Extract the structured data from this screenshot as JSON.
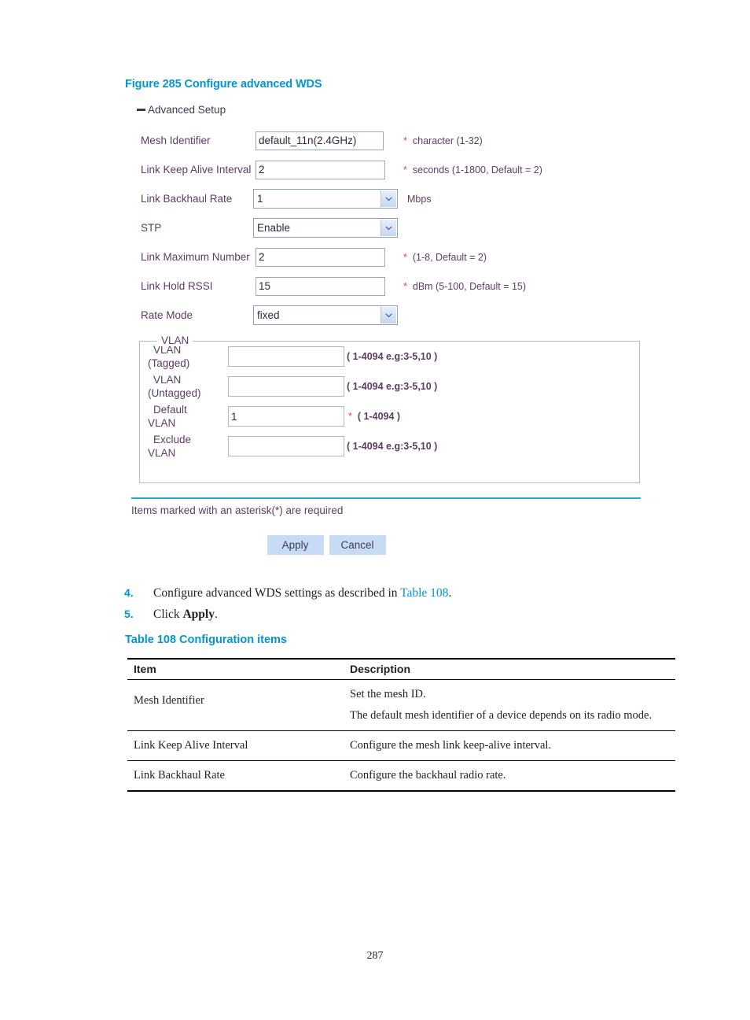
{
  "figure": {
    "caption": "Figure 285 Configure advanced WDS"
  },
  "ui": {
    "section_header": "Advanced Setup",
    "fields": [
      {
        "label": "Mesh Identifier",
        "type": "text",
        "value": "default_11n(2.4GHz)",
        "required": "*",
        "hint": "character (1-32)"
      },
      {
        "label": "Link Keep Alive Interval",
        "type": "text",
        "value": "2",
        "required": "*",
        "hint": "seconds (1-1800, Default = 2)"
      },
      {
        "label": "Link Backhaul Rate",
        "type": "select",
        "value": "1",
        "required": "",
        "hint": "Mbps"
      },
      {
        "label": "STP",
        "type": "select",
        "value": "Enable",
        "required": "",
        "hint": ""
      },
      {
        "label": "Link Maximum Number",
        "type": "text",
        "value": "2",
        "required": "*",
        "hint": "(1-8, Default = 2)"
      },
      {
        "label": "Link Hold RSSI",
        "type": "text",
        "value": "15",
        "required": "*",
        "hint": "dBm (5-100, Default = 15)"
      },
      {
        "label": "Rate Mode",
        "type": "select",
        "value": "fixed",
        "required": "",
        "hint": ""
      }
    ],
    "vlan": {
      "legend": "VLAN",
      "rows": [
        {
          "label_line1": "VLAN",
          "label_line2": "(Tagged)",
          "value": "",
          "required": "",
          "hint": "( 1-4094 e.g:3-5,10 )"
        },
        {
          "label_line1": "VLAN",
          "label_line2": "(Untagged)",
          "value": "",
          "required": "",
          "hint": "( 1-4094 e.g:3-5,10 )"
        },
        {
          "label_line1": "Default",
          "label_line2": "VLAN",
          "value": "1",
          "required": "*",
          "hint": "( 1-4094 )"
        },
        {
          "label_line1": "Exclude",
          "label_line2": "VLAN",
          "value": "",
          "required": "",
          "hint": "( 1-4094 e.g:3-5,10 )"
        }
      ]
    },
    "required_note": "Items marked with an asterisk(*) are required",
    "buttons": {
      "apply": "Apply",
      "cancel": "Cancel"
    }
  },
  "steps": [
    {
      "num": "4.",
      "text_before": "Configure advanced WDS settings as described in ",
      "link": "Table 108",
      "text_after": "."
    },
    {
      "num": "5.",
      "text_before": "Click ",
      "bold": "Apply",
      "text_after": "."
    }
  ],
  "table": {
    "caption": "Table 108 Configuration items",
    "headers": [
      "Item",
      "Description"
    ],
    "rows": [
      {
        "item": "Mesh Identifier",
        "desc_line1": "Set the mesh ID.",
        "desc_line2": "The default mesh identifier of a device depends on its radio mode."
      },
      {
        "item": "Link Keep Alive Interval",
        "desc_line1": "Configure the mesh link keep-alive interval.",
        "desc_line2": ""
      },
      {
        "item": "Link Backhaul Rate",
        "desc_line1": "Configure the backhaul radio rate.",
        "desc_line2": ""
      }
    ]
  },
  "page_number": "287",
  "colors": {
    "accent": "#0096d6",
    "divider": "#29a3dc",
    "required_asterisk": "#e8396a",
    "button_bg": "#c7dcf4"
  }
}
